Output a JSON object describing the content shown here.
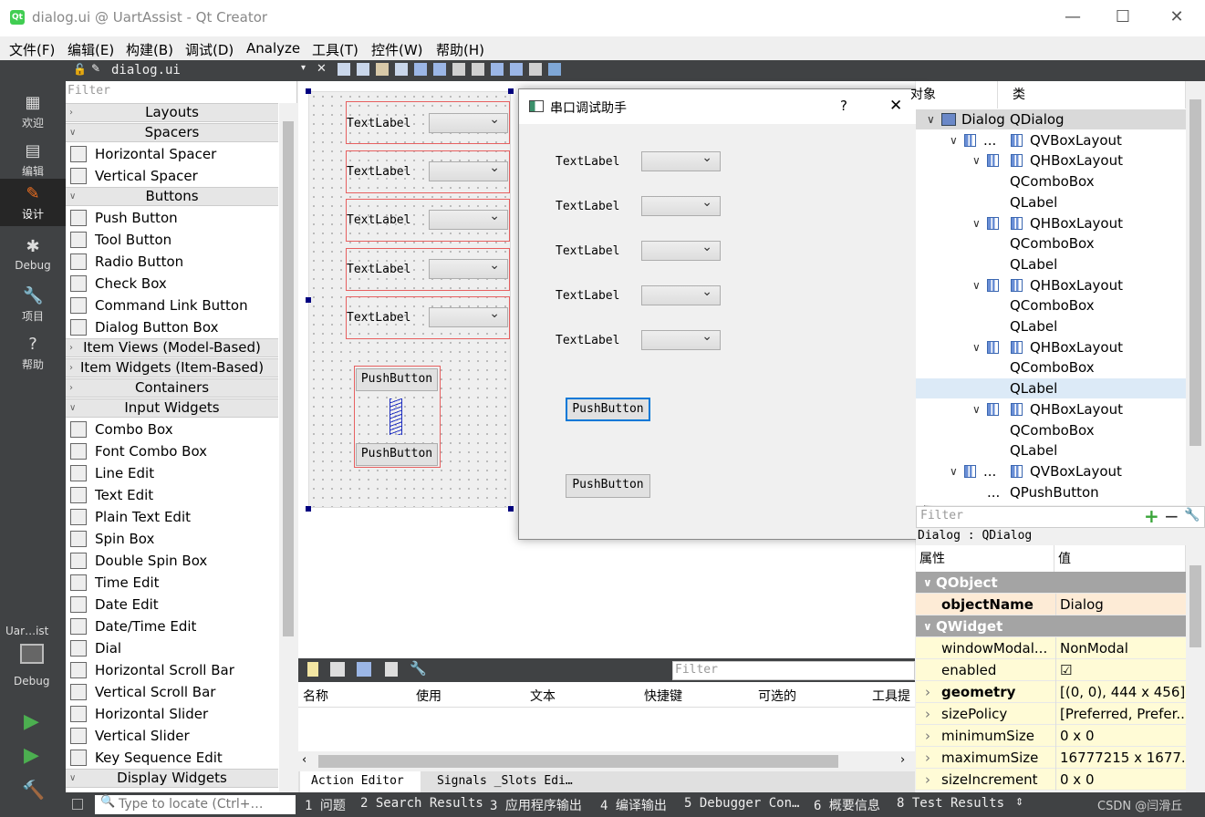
{
  "window": {
    "title": "dialog.ui @ UartAssist - Qt Creator",
    "logo": "Qt",
    "min": "—",
    "max": "☐",
    "close": "✕"
  },
  "menu": [
    "文件(F)",
    "编辑(E)",
    "构建(B)",
    "调试(D)",
    "Analyze",
    "工具(T)",
    "控件(W)",
    "帮助(H)"
  ],
  "modes": [
    {
      "label": "欢迎",
      "icon": "grid-icon"
    },
    {
      "label": "编辑",
      "icon": "edit-icon"
    },
    {
      "label": "设计",
      "icon": "pencil-icon"
    },
    {
      "label": "Debug",
      "icon": "bug-icon"
    },
    {
      "label": "项目",
      "icon": "wrench-icon"
    },
    {
      "label": "帮助",
      "icon": "help-icon"
    }
  ],
  "kit": {
    "name": "Uar…ist",
    "mode": "Debug"
  },
  "editor_tab": {
    "file": "dialog.ui"
  },
  "widgetbox": {
    "filter_placeholder": "Filter",
    "items": [
      {
        "type": "cat",
        "label": "Layouts",
        "collapsed": true
      },
      {
        "type": "cat",
        "label": "Spacers"
      },
      {
        "type": "item",
        "label": "Horizontal Spacer",
        "icon": "hspacer-icon"
      },
      {
        "type": "item",
        "label": "Vertical Spacer",
        "icon": "vspacer-icon"
      },
      {
        "type": "cat",
        "label": "Buttons"
      },
      {
        "type": "item",
        "label": "Push Button",
        "icon": "pushbutton-icon"
      },
      {
        "type": "item",
        "label": "Tool Button",
        "icon": "toolbutton-icon"
      },
      {
        "type": "item",
        "label": "Radio Button",
        "icon": "radio-icon"
      },
      {
        "type": "item",
        "label": "Check Box",
        "icon": "checkbox-icon"
      },
      {
        "type": "item",
        "label": "Command Link Button",
        "icon": "commandlink-icon"
      },
      {
        "type": "item",
        "label": "Dialog Button Box",
        "icon": "dialogbuttonbox-icon"
      },
      {
        "type": "cat",
        "label": "Item Views (Model-Based)",
        "collapsed": true
      },
      {
        "type": "cat",
        "label": "Item Widgets (Item-Based)",
        "collapsed": true
      },
      {
        "type": "cat",
        "label": "Containers",
        "collapsed": true
      },
      {
        "type": "cat",
        "label": "Input Widgets"
      },
      {
        "type": "item",
        "label": "Combo Box",
        "icon": "combobox-icon"
      },
      {
        "type": "item",
        "label": "Font Combo Box",
        "icon": "fontcombo-icon"
      },
      {
        "type": "item",
        "label": "Line Edit",
        "icon": "lineedit-icon"
      },
      {
        "type": "item",
        "label": "Text Edit",
        "icon": "textedit-icon"
      },
      {
        "type": "item",
        "label": "Plain Text Edit",
        "icon": "plaintextedit-icon"
      },
      {
        "type": "item",
        "label": "Spin Box",
        "icon": "spinbox-icon"
      },
      {
        "type": "item",
        "label": "Double Spin Box",
        "icon": "doublespinbox-icon"
      },
      {
        "type": "item",
        "label": "Time Edit",
        "icon": "timeedit-icon"
      },
      {
        "type": "item",
        "label": "Date Edit",
        "icon": "dateedit-icon"
      },
      {
        "type": "item",
        "label": "Date/Time Edit",
        "icon": "datetimeedit-icon"
      },
      {
        "type": "item",
        "label": "Dial",
        "icon": "dial-icon"
      },
      {
        "type": "item",
        "label": "Horizontal Scroll Bar",
        "icon": "hscrollbar-icon"
      },
      {
        "type": "item",
        "label": "Vertical Scroll Bar",
        "icon": "vscrollbar-icon"
      },
      {
        "type": "item",
        "label": "Horizontal Slider",
        "icon": "hslider-icon"
      },
      {
        "type": "item",
        "label": "Vertical Slider",
        "icon": "vslider-icon"
      },
      {
        "type": "item",
        "label": "Key Sequence Edit",
        "icon": "keysequence-icon"
      },
      {
        "type": "cat",
        "label": "Display Widgets"
      }
    ]
  },
  "form": {
    "label": "TextLabel",
    "button": "PushButton"
  },
  "preview": {
    "title": "串口调试助手",
    "help": "?",
    "close": "✕",
    "label": "TextLabel",
    "button1": "PushButton",
    "button2": "PushButton"
  },
  "objinsp": {
    "col_object": "对象",
    "col_class": "类",
    "rows": [
      {
        "indent": 0,
        "obj": "Dialog",
        "cls": "QDialog",
        "sel": true,
        "exp": "∨"
      },
      {
        "indent": 1,
        "obj": "...",
        "cls": "QVBoxLayout",
        "exp": "∨",
        "icon": "vbox"
      },
      {
        "indent": 2,
        "obj": "",
        "cls": "QHBoxLayout",
        "exp": "∨",
        "icon": "hbox"
      },
      {
        "indent": 3,
        "obj": "",
        "cls": "QComboBox"
      },
      {
        "indent": 3,
        "obj": "",
        "cls": "QLabel"
      },
      {
        "indent": 2,
        "obj": "",
        "cls": "QHBoxLayout",
        "exp": "∨",
        "icon": "hbox"
      },
      {
        "indent": 3,
        "obj": "",
        "cls": "QComboBox"
      },
      {
        "indent": 3,
        "obj": "",
        "cls": "QLabel"
      },
      {
        "indent": 2,
        "obj": "",
        "cls": "QHBoxLayout",
        "exp": "∨",
        "icon": "hbox"
      },
      {
        "indent": 3,
        "obj": "",
        "cls": "QComboBox"
      },
      {
        "indent": 3,
        "obj": "",
        "cls": "QLabel"
      },
      {
        "indent": 2,
        "obj": "",
        "cls": "QHBoxLayout",
        "exp": "∨",
        "icon": "hbox"
      },
      {
        "indent": 3,
        "obj": "",
        "cls": "QComboBox"
      },
      {
        "indent": 3,
        "obj": "",
        "cls": "QLabel",
        "hl": true
      },
      {
        "indent": 2,
        "obj": "",
        "cls": "QHBoxLayout",
        "exp": "∨",
        "icon": "hbox"
      },
      {
        "indent": 3,
        "obj": "",
        "cls": "QComboBox"
      },
      {
        "indent": 3,
        "obj": "",
        "cls": "QLabel"
      },
      {
        "indent": 1,
        "obj": "...",
        "cls": "QVBoxLayout",
        "exp": "∨",
        "icon": "vbox"
      },
      {
        "indent": 3,
        "obj": "...",
        "cls": "QPushButton"
      }
    ]
  },
  "propeditor": {
    "filter_placeholder": "Filter",
    "plus": "+",
    "minus": "−",
    "context": "Dialog : QDialog",
    "col_prop": "属性",
    "col_val": "值",
    "rows": [
      {
        "kind": "grp",
        "name": "QObject"
      },
      {
        "kind": "org",
        "name": "objectName",
        "val": "Dialog",
        "bold": true
      },
      {
        "kind": "grp",
        "name": "QWidget"
      },
      {
        "kind": "yel",
        "name": "windowModal...",
        "val": "NonModal"
      },
      {
        "kind": "yel",
        "name": "enabled",
        "val": "☑"
      },
      {
        "kind": "yel",
        "name": "geometry",
        "val": "[(0, 0), 444 x 456]",
        "bold": true,
        "exp": "›"
      },
      {
        "kind": "yel",
        "name": "sizePolicy",
        "val": "[Preferred, Prefer...",
        "exp": "›"
      },
      {
        "kind": "yel",
        "name": "minimumSize",
        "val": "0 x 0",
        "exp": "›"
      },
      {
        "kind": "yel",
        "name": "maximumSize",
        "val": "16777215 x 1677...",
        "exp": "›"
      },
      {
        "kind": "yel",
        "name": "sizeIncrement",
        "val": "0 x 0",
        "exp": "›"
      }
    ]
  },
  "action_editor": {
    "filter_placeholder": "Filter",
    "cols": [
      "名称",
      "使用",
      "文本",
      "快捷键",
      "可选的",
      "工具提"
    ],
    "tabs": [
      "Action Editor",
      "Signals _Slots Edi…"
    ]
  },
  "statusbar": {
    "locate_placeholder": "Type to locate (Ctrl+…",
    "items": [
      "1 问题",
      "2 Search Results",
      "3 应用程序输出",
      "4 编译输出",
      "5 Debugger Con…",
      "6 概要信息",
      "8 Test Results"
    ],
    "watermark": "CSDN @闫滑丘"
  }
}
